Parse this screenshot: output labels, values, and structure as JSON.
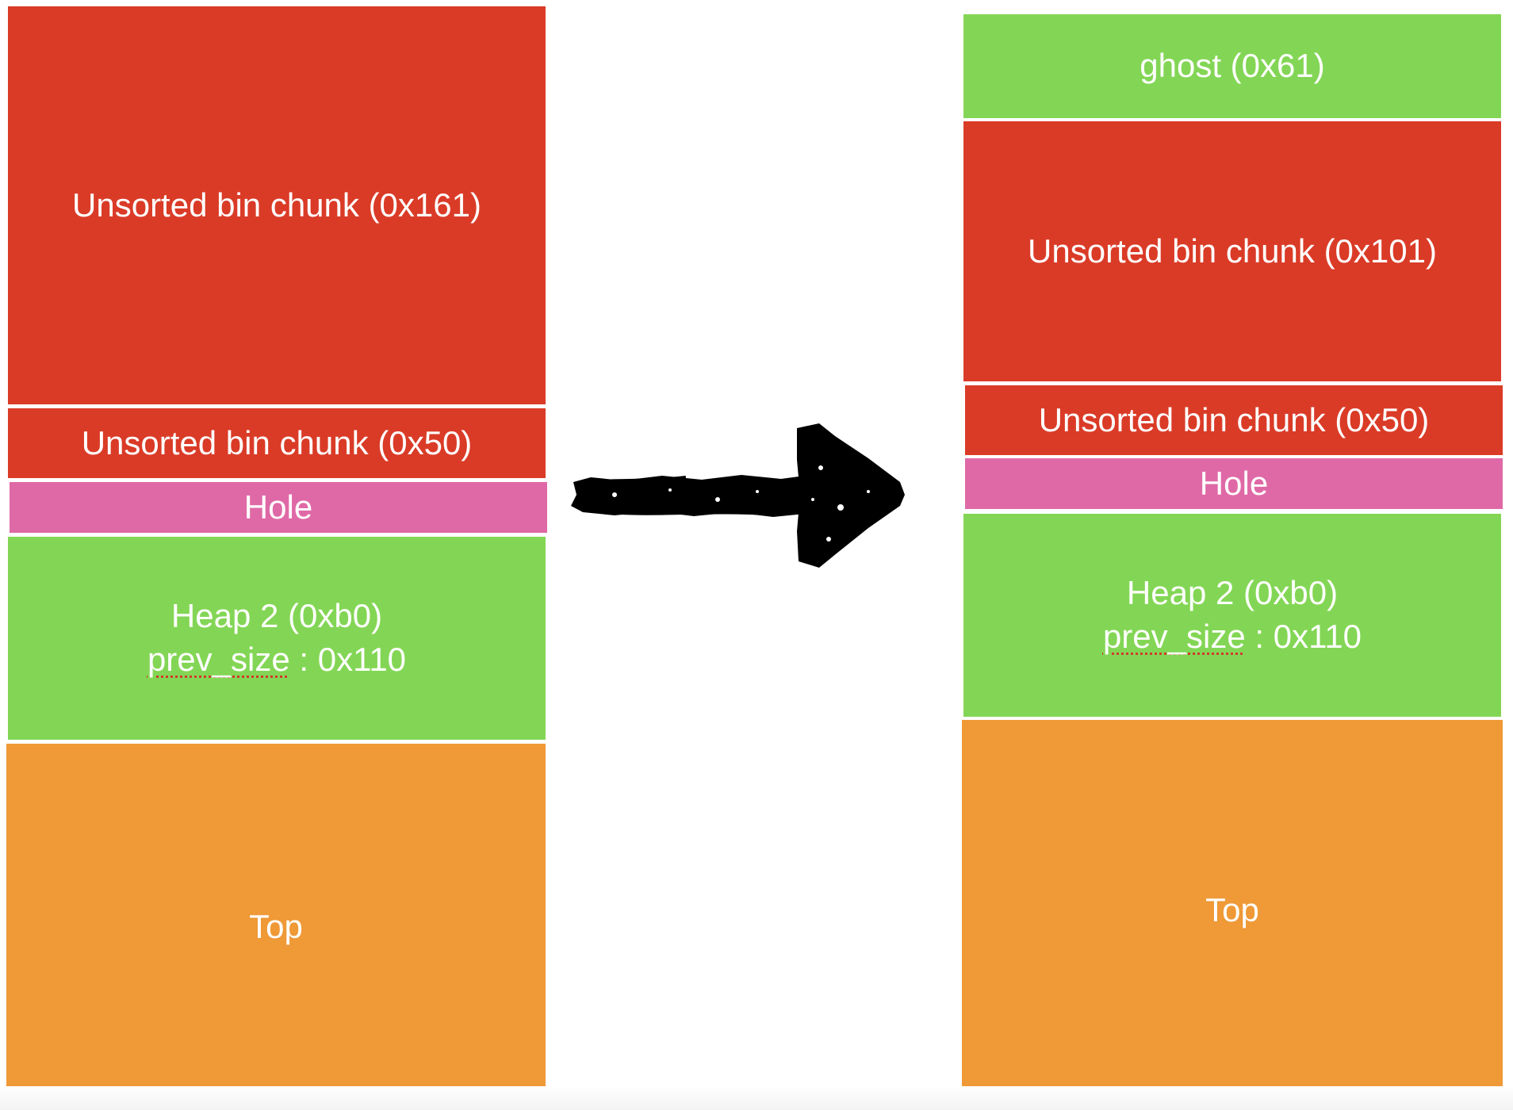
{
  "before": {
    "unsorted_big": "Unsorted bin chunk (0x161)",
    "unsorted_small": "Unsorted bin chunk (0x50)",
    "hole": "Hole",
    "heap2_title": "Heap 2 (0xb0)",
    "heap2_prev_label": "prev_size",
    "heap2_prev_value": " : 0x110",
    "top": "Top"
  },
  "after": {
    "ghost": "ghost (0x61)",
    "unsorted_big": "Unsorted bin chunk (0x101)",
    "unsorted_small": "Unsorted bin chunk (0x50)",
    "hole": "Hole",
    "heap2_title": "Heap 2 (0xb0)",
    "heap2_prev_label": "prev_size",
    "heap2_prev_value": " : 0x110",
    "top": "Top"
  },
  "colors": {
    "unsorted_chunk": "#da3b27",
    "hole": "#df69a6",
    "heap_chunk": "#83d655",
    "top_chunk": "#ef9937",
    "arrow": "#000000"
  },
  "icons": {
    "transition": "right-arrow-icon"
  }
}
